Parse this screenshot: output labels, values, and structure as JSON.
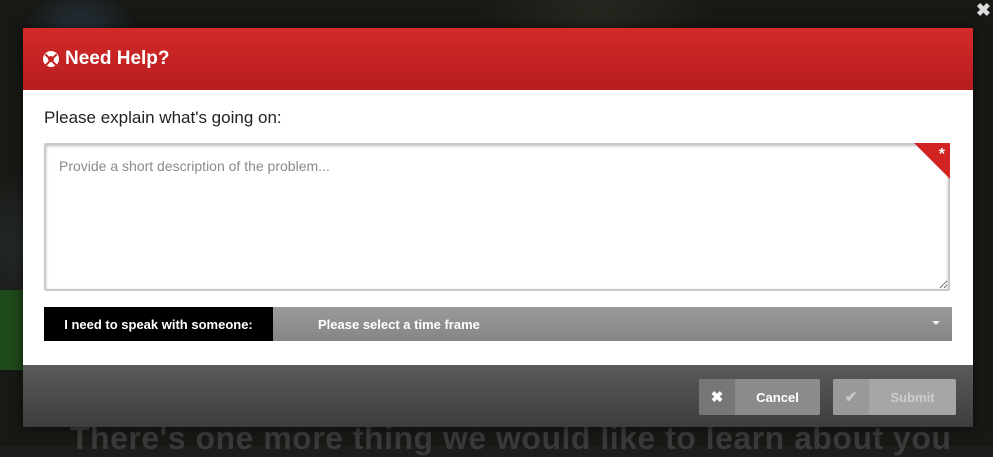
{
  "background": {
    "headline": "There's one more thing we would like to learn about you"
  },
  "modal": {
    "title": "Need Help?",
    "header_icon": "lifebuoy-icon",
    "prompt": "Please explain what's going on:",
    "description": {
      "value": "",
      "placeholder": "Provide a short description of the problem...",
      "required_marker": "*"
    },
    "speak": {
      "label": "I need to speak with someone:",
      "selected": "Please select a time frame"
    },
    "buttons": {
      "cancel": {
        "label": "Cancel",
        "icon": "close-icon"
      },
      "submit": {
        "label": "Submit",
        "icon": "check-icon"
      }
    }
  },
  "colors": {
    "header_red": "#c42222",
    "required_red": "#d32424",
    "footer_dark": "#4a4a4a"
  }
}
